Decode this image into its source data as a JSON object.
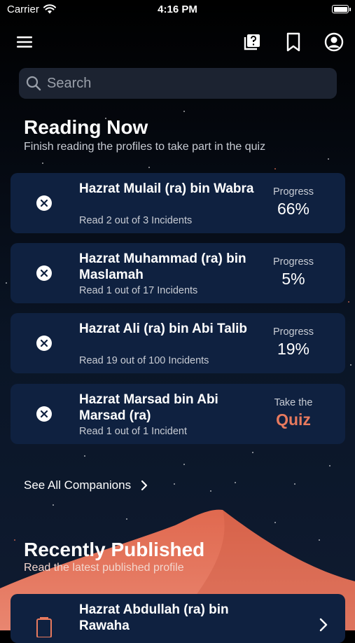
{
  "status_bar": {
    "carrier": "Carrier",
    "time": "4:16 PM"
  },
  "nav": {
    "icons": [
      "menu-icon",
      "quiz-question-icon",
      "bookmark-icon",
      "profile-icon"
    ]
  },
  "search": {
    "placeholder": "Search",
    "value": ""
  },
  "reading_now": {
    "title": "Reading Now",
    "subtitle": "Finish reading the profiles to take part in the quiz",
    "items": [
      {
        "name": "Hazrat Mulail (ra) bin Wabra",
        "read": "Read 2 out of 3 Incidents",
        "label": "Progress",
        "value": "66%"
      },
      {
        "name": "Hazrat Muhammad (ra) bin Maslamah",
        "read": "Read 1 out of 17 Incidents",
        "label": "Progress",
        "value": "5%"
      },
      {
        "name": "Hazrat Ali (ra) bin Abi Talib",
        "read": "Read 19 out of 100 Incidents",
        "label": "Progress",
        "value": "19%"
      },
      {
        "name": "Hazrat Marsad bin Abi Marsad (ra)",
        "read": "Read 1 out of 1 Incident",
        "label": "Take the",
        "value": "Quiz"
      }
    ]
  },
  "see_all": {
    "label": "See All Companions"
  },
  "recently_published": {
    "title": "Recently Published",
    "subtitle": "Read the latest published profile",
    "items": [
      {
        "name": "Hazrat Abdullah (ra) bin Rawaha"
      }
    ]
  },
  "colors": {
    "card": "#0f2140",
    "accent": "#e87a5e",
    "dune": "#e0694f"
  }
}
